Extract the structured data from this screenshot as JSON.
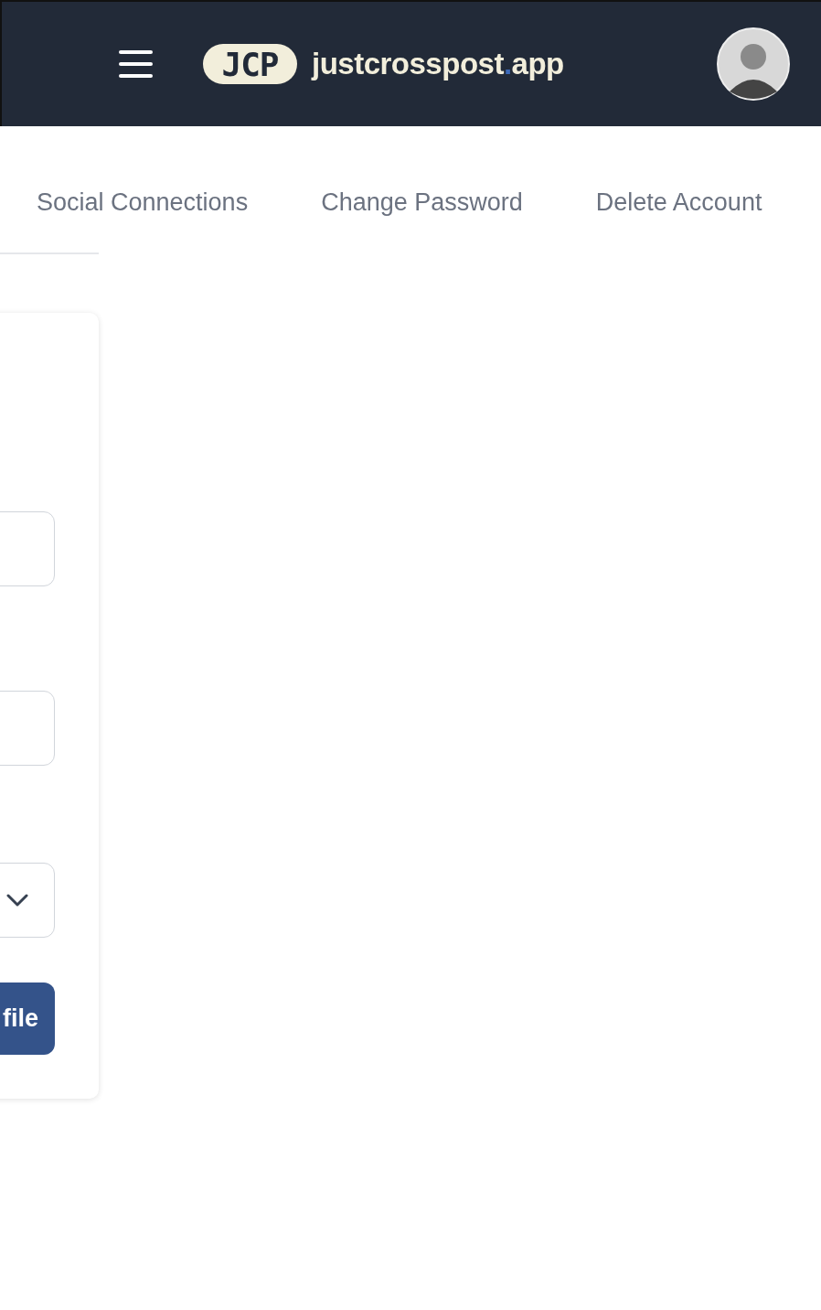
{
  "header": {
    "logo_badge": "JCP",
    "brand": {
      "name": "justcrosspost",
      "dot": ".",
      "tld": "app"
    }
  },
  "tabs": [
    {
      "label": "Social Connections",
      "selected": false
    },
    {
      "label": "Change Password",
      "selected": false
    },
    {
      "label": "Delete Account",
      "selected": false
    }
  ],
  "form": {
    "fields": [
      {
        "kind": "input"
      },
      {
        "kind": "input"
      },
      {
        "kind": "select"
      }
    ],
    "submit": {
      "label": "file"
    }
  }
}
